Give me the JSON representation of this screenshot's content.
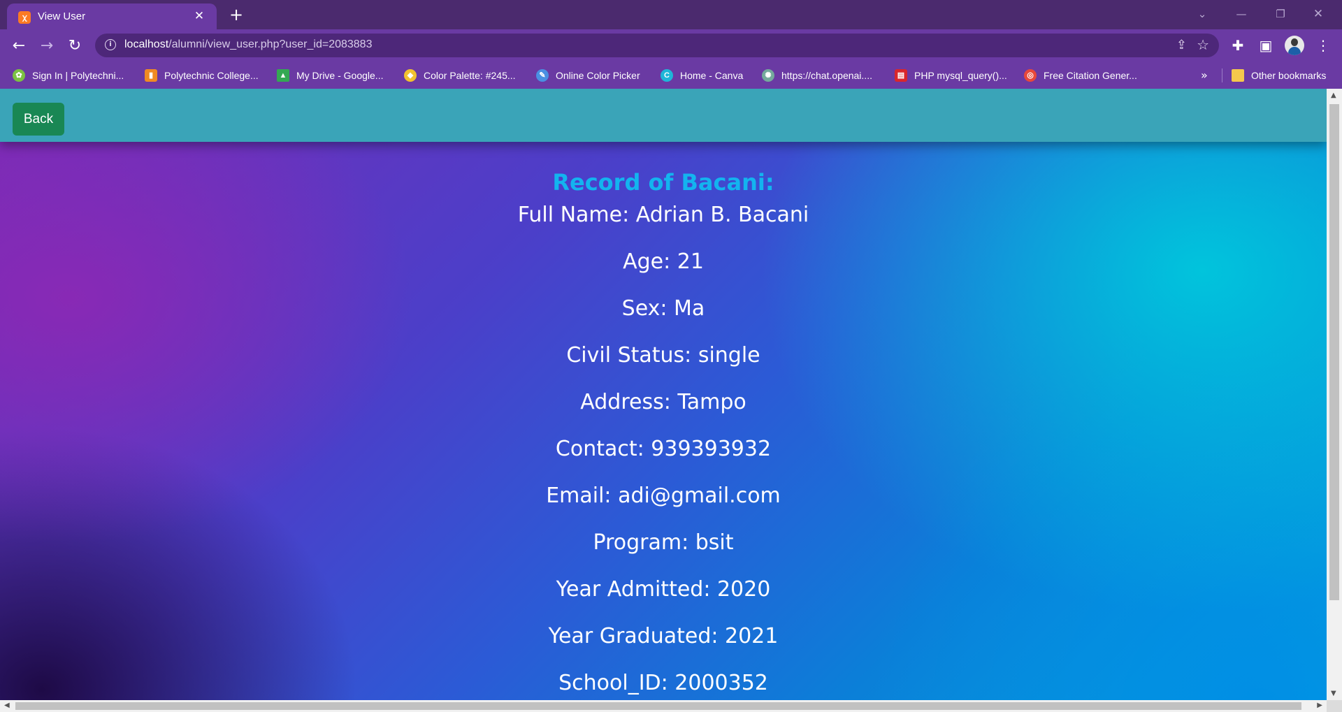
{
  "browser": {
    "tab_title": "View User",
    "tab_favicon": "xampp-icon",
    "url_host": "localhost",
    "url_path": "/alumni/view_user.php?user_id=2083883",
    "bookmarks": [
      {
        "label": "Sign In | Polytechni...",
        "icon": "globe-icon",
        "color": "#7cc242"
      },
      {
        "label": "Polytechnic College...",
        "icon": "chart-icon",
        "color": "#f08a24"
      },
      {
        "label": "My Drive - Google...",
        "icon": "drive-icon",
        "color": "#34a853"
      },
      {
        "label": "Color Palette: #245...",
        "icon": "palette-icon",
        "color": "#f2c12e"
      },
      {
        "label": "Online Color Picker",
        "icon": "picker-icon",
        "color": "#4a90e2"
      },
      {
        "label": "Home - Canva",
        "icon": "canva-icon",
        "color": "#1fb6d8"
      },
      {
        "label": "https://chat.openai....",
        "icon": "openai-icon",
        "color": "#74aa9c"
      },
      {
        "label": "PHP mysql_query()...",
        "icon": "php-icon",
        "color": "#d9262c"
      },
      {
        "label": "Free Citation Gener...",
        "icon": "citation-icon",
        "color": "#e8483a"
      }
    ],
    "other_bookmarks": "Other bookmarks"
  },
  "page": {
    "back_label": "Back",
    "record_title": "Record of Bacani:",
    "fields": [
      "Full Name: Adrian B. Bacani",
      "Age: 21",
      "Sex: Ma",
      "Civil Status: single",
      "Address: Tampo",
      "Contact: 939393932",
      "Email: adi@gmail.com",
      "Program: bsit",
      "Year Admitted: 2020",
      "Year Graduated: 2021",
      "School_ID: 2000352"
    ]
  },
  "colors": {
    "header_bar": "#3aa4b8",
    "back_button": "#198754",
    "title_text": "#13b4ef",
    "chrome_accent": "#6a3aa3"
  }
}
